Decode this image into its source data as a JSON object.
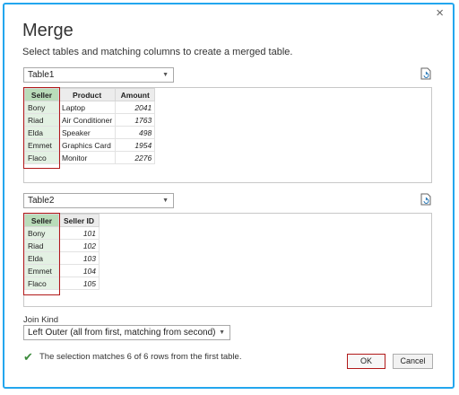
{
  "dialog": {
    "close_glyph": "×",
    "title": "Merge",
    "subtitle": "Select tables and matching columns to create a merged table."
  },
  "table1": {
    "select_value": "Table1",
    "columns": [
      "Seller",
      "Product",
      "Amount"
    ],
    "rows": [
      [
        "Bony",
        "Laptop",
        "2041"
      ],
      [
        "Riad",
        "Air Conditioner",
        "1763"
      ],
      [
        "Elda",
        "Speaker",
        "498"
      ],
      [
        "Emmet",
        "Graphics Card",
        "1954"
      ],
      [
        "Flaco",
        "Monitor",
        "2276"
      ]
    ],
    "selected_column": "Seller"
  },
  "table2": {
    "select_value": "Table2",
    "columns": [
      "Seller",
      "Seller ID"
    ],
    "rows": [
      [
        "Bony",
        "101"
      ],
      [
        "Riad",
        "102"
      ],
      [
        "Elda",
        "103"
      ],
      [
        "Emmet",
        "104"
      ],
      [
        "Flaco",
        "105"
      ]
    ],
    "selected_column": "Seller"
  },
  "join": {
    "label": "Join Kind",
    "value": "Left Outer (all from first, matching from second)"
  },
  "status": {
    "icon": "check-icon",
    "text": "The selection matches 6 of 6 rows from the first table."
  },
  "buttons": {
    "ok": "OK",
    "cancel": "Cancel"
  },
  "colors": {
    "accent_border": "#23a6ee",
    "highlight": "#b11919",
    "selected_column": "#e3f1e3",
    "check": "#3c8b3c"
  }
}
